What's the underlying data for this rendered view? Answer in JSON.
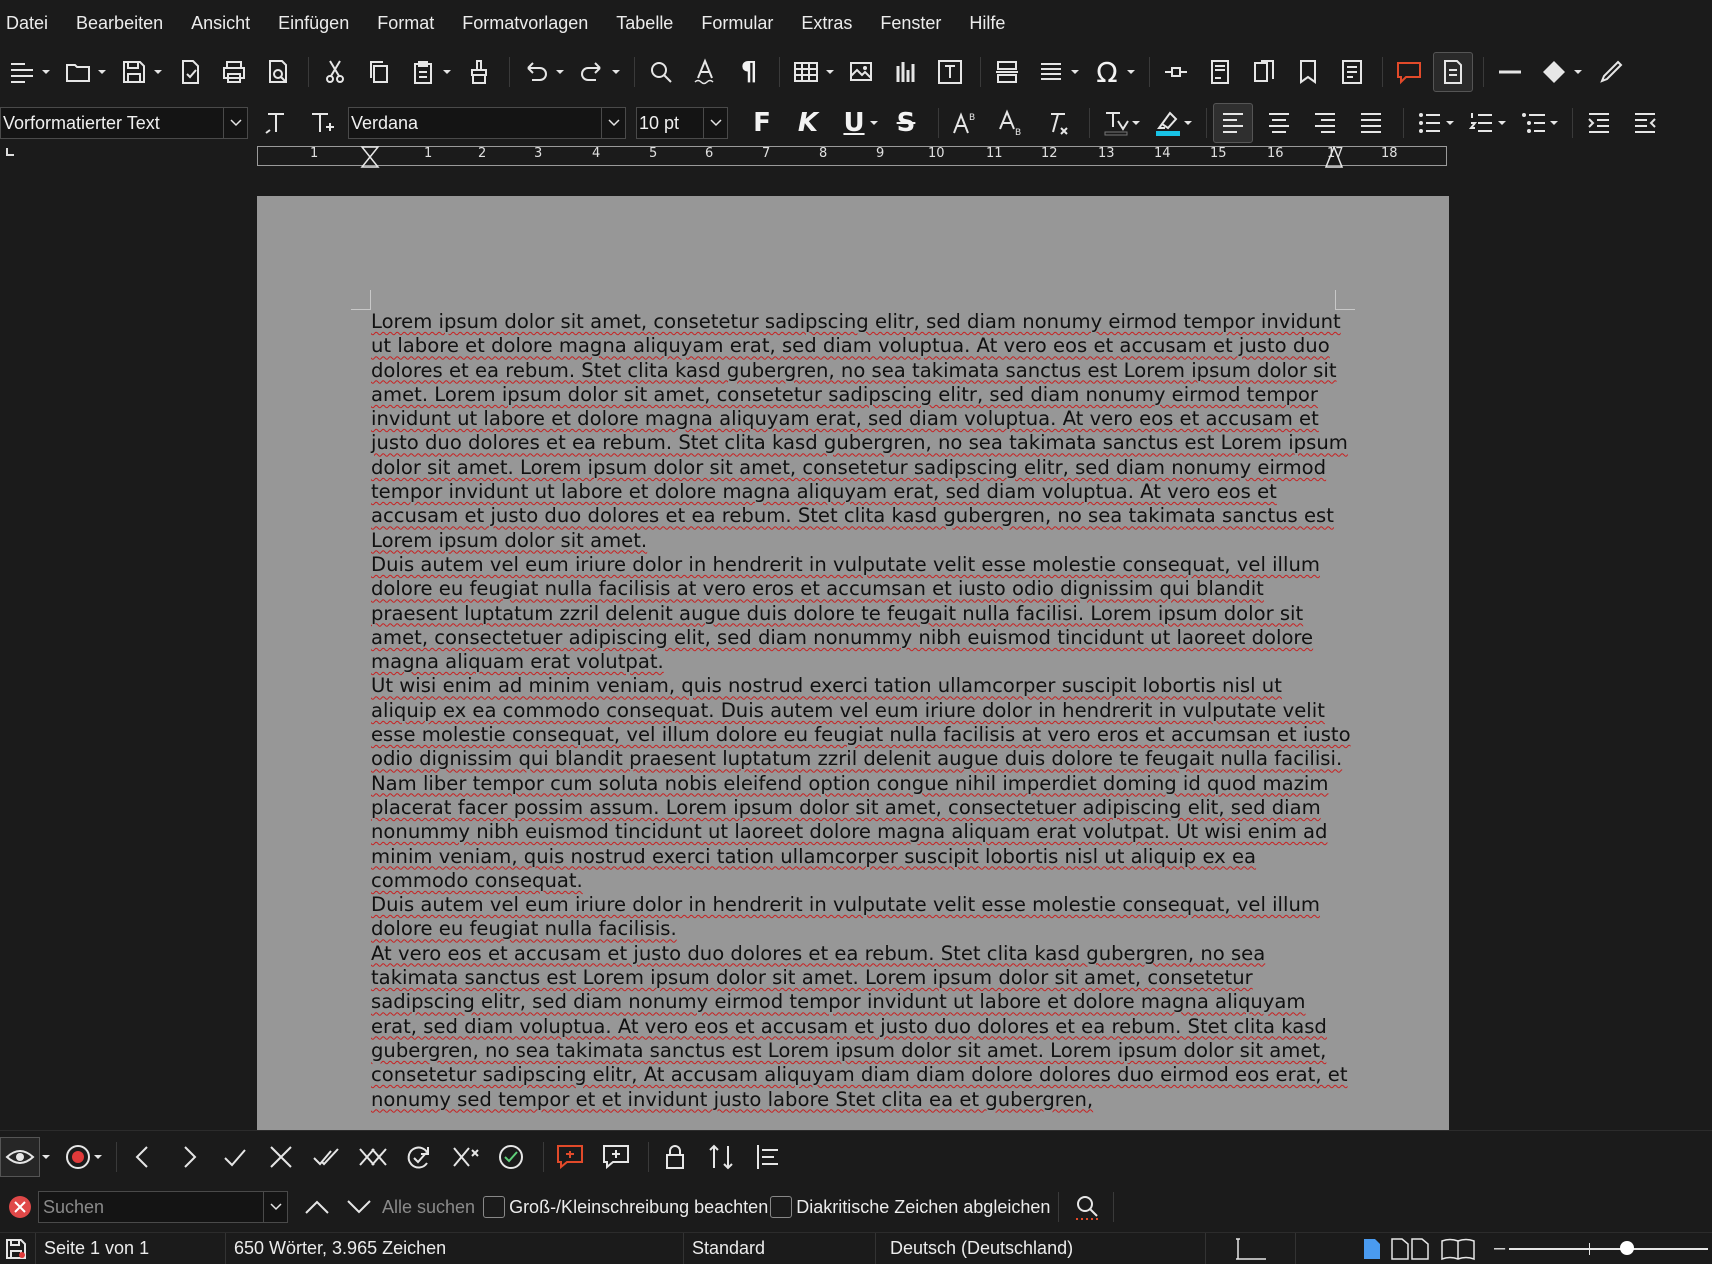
{
  "menubar": {
    "items": [
      "Datei",
      "Bearbeiten",
      "Ansicht",
      "Einfügen",
      "Format",
      "Formatvorlagen",
      "Tabelle",
      "Formular",
      "Extras",
      "Fenster",
      "Hilfe"
    ]
  },
  "formatting": {
    "paragraph_style": "Vorformatierter Text",
    "font_name": "Verdana",
    "font_size": "10 pt",
    "bold_label": "F",
    "italic_label": "K",
    "underline_label": "U",
    "strike_label": "S"
  },
  "ruler": {
    "numbers": [
      "1",
      "1",
      "2",
      "3",
      "4",
      "5",
      "6",
      "7",
      "8",
      "9",
      "10",
      "11",
      "12",
      "13",
      "14",
      "15",
      "16",
      "17",
      "18"
    ]
  },
  "document": {
    "paragraphs": [
      "Lorem ipsum dolor sit amet, consetetur sadipscing elitr,  sed diam nonumy eirmod tempor invidunt ut labore et dolore magna aliquyam erat, sed diam voluptua. At vero eos et accusam et justo duo dolores et ea rebum. Stet clita kasd gubergren, no sea takimata sanctus est Lorem ipsum dolor sit amet. Lorem ipsum dolor sit amet, consetetur sadipscing elitr,  sed diam nonumy eirmod tempor invidunt ut labore et dolore magna aliquyam erat, sed diam voluptua. At vero eos et accusam et justo duo dolores et ea rebum. Stet clita kasd gubergren, no sea takimata sanctus est Lorem ipsum dolor sit amet. Lorem ipsum dolor sit amet, consetetur sadipscing elitr,  sed diam nonumy eirmod tempor invidunt ut labore et dolore magna aliquyam erat, sed diam voluptua. At vero eos et accusam et justo duo dolores et ea rebum. Stet clita kasd gubergren, no sea takimata sanctus est Lorem ipsum dolor sit amet.",
      "Duis autem vel eum iriure dolor in hendrerit in vulputate velit esse molestie consequat, vel illum dolore eu feugiat nulla facilisis at vero eros et accumsan et iusto odio dignissim qui blandit praesent luptatum zzril delenit augue duis dolore te feugait nulla facilisi. Lorem ipsum dolor sit amet, consectetuer adipiscing elit, sed diam nonummy nibh euismod tincidunt ut laoreet dolore magna aliquam erat volutpat.",
      "Ut wisi enim ad minim veniam, quis nostrud exerci tation ullamcorper suscipit lobortis nisl ut aliquip ex ea commodo consequat. Duis autem vel eum iriure dolor in hendrerit in vulputate velit esse molestie consequat, vel illum dolore eu feugiat nulla facilisis at vero eros et accumsan et iusto odio dignissim qui blandit praesent luptatum zzril delenit augue duis dolore te feugait nulla facilisi.",
      "Nam liber tempor cum soluta nobis eleifend option congue nihil imperdiet doming id quod mazim placerat facer possim assum. Lorem ipsum dolor sit amet, consectetuer adipiscing elit, sed diam nonummy nibh euismod tincidunt ut laoreet dolore magna aliquam erat volutpat. Ut wisi enim ad minim veniam, quis nostrud exerci tation ullamcorper suscipit lobortis nisl ut aliquip ex ea commodo consequat.",
      "Duis autem vel eum iriure dolor in hendrerit in vulputate velit esse molestie consequat, vel illum dolore eu feugiat nulla facilisis.",
      "At vero eos et accusam et justo duo dolores et ea rebum. Stet clita kasd gubergren, no sea takimata sanctus est Lorem ipsum dolor sit amet. Lorem ipsum dolor sit amet, consetetur sadipscing elitr,  sed diam nonumy eirmod tempor invidunt ut labore et dolore magna aliquyam erat, sed diam voluptua. At vero eos et accusam et justo duo dolores et ea rebum. Stet clita kasd gubergren, no sea takimata sanctus est Lorem ipsum dolor sit amet. Lorem ipsum dolor sit amet, consetetur sadipscing elitr,  At accusam aliquyam diam diam dolore dolores duo eirmod eos erat, et nonumy sed tempor et et invidunt justo labore Stet clita ea et gubergren,"
    ]
  },
  "findbar": {
    "placeholder": "Suchen",
    "find_all": "Alle suchen",
    "match_case": "Groß-/Kleinschreibung beachten",
    "diacritics": "Diakritische Zeichen abgleichen"
  },
  "statusbar": {
    "page": "Seite 1 von 1",
    "words": "650 Wörter, 3.965 Zeichen",
    "page_style": "Standard",
    "language": "Deutsch (Deutschland)"
  },
  "colors": {
    "accent_red": "#e24a2a",
    "highlight_cyan": "#19c3e6",
    "spellcheck": "#c92020",
    "page_bg": "#979797"
  }
}
